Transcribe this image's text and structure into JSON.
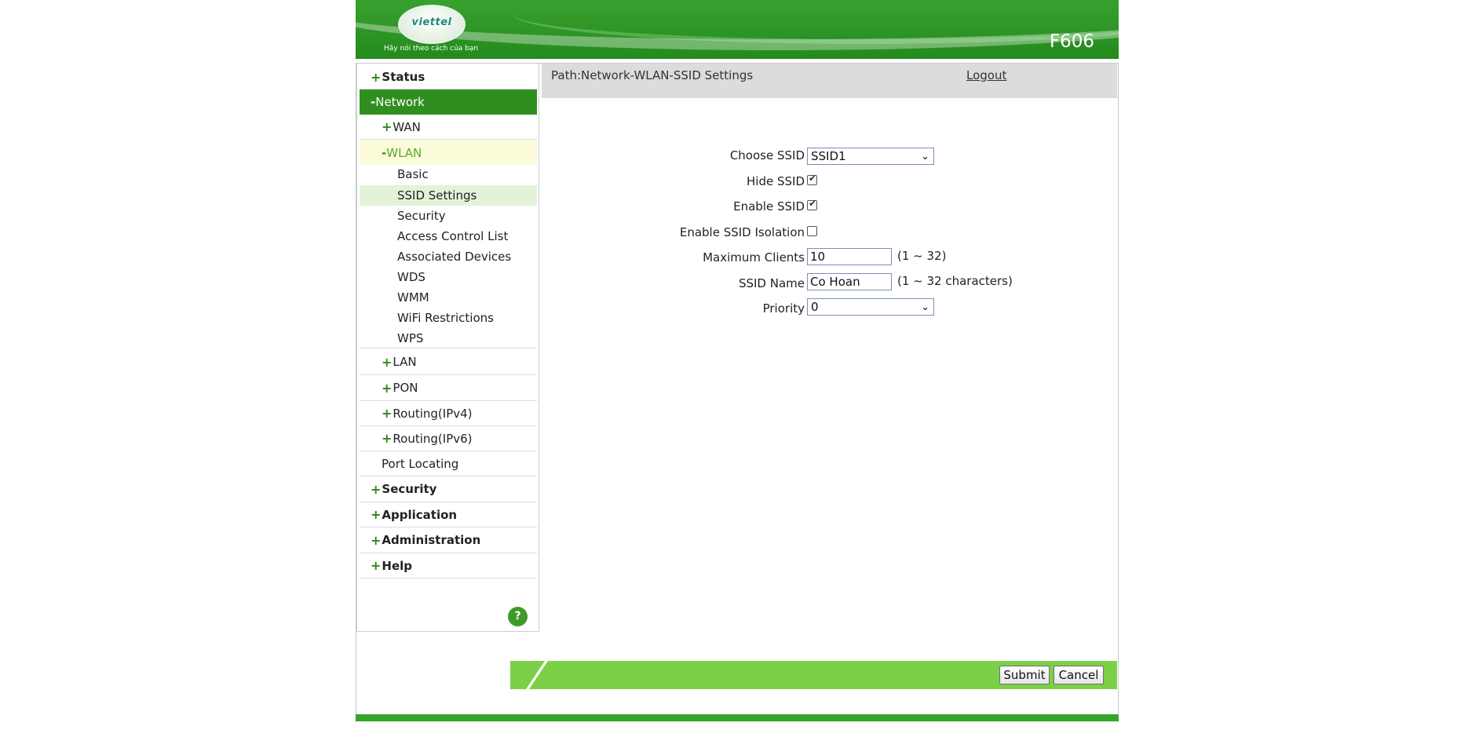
{
  "header": {
    "brand": "viettel",
    "tagline": "Hãy nói theo cách của bạn",
    "model": "F606"
  },
  "sidebar": {
    "status": "Status",
    "network": "Network",
    "wan": "WAN",
    "wlan": "WLAN",
    "wlan_items": [
      "Basic",
      "SSID Settings",
      "Security",
      "Access Control List",
      "Associated Devices",
      "WDS",
      "WMM",
      "WiFi Restrictions",
      "WPS"
    ],
    "lan": "LAN",
    "pon": "PON",
    "routing4": "Routing(IPv4)",
    "routing6": "Routing(IPv6)",
    "port_locating": "Port Locating",
    "security": "Security",
    "application": "Application",
    "administration": "Administration",
    "help": "Help",
    "help_icon": "?"
  },
  "content": {
    "path": "Path:Network-WLAN-SSID Settings",
    "logout": "Logout",
    "form": {
      "choose_ssid_label": "Choose SSID",
      "choose_ssid_value": "SSID1",
      "hide_ssid_label": "Hide SSID",
      "hide_ssid_checked": true,
      "enable_ssid_label": "Enable SSID",
      "enable_ssid_checked": true,
      "isolation_label": "Enable SSID Isolation",
      "isolation_checked": false,
      "max_clients_label": "Maximum Clients",
      "max_clients_value": "10",
      "max_clients_hint": "(1 ~ 32)",
      "ssid_name_label": "SSID Name",
      "ssid_name_value": "Co Hoan",
      "ssid_name_hint": "(1 ~ 32 characters)",
      "priority_label": "Priority",
      "priority_value": "0"
    },
    "buttons": {
      "submit": "Submit",
      "cancel": "Cancel"
    }
  },
  "colors": {
    "brand_green": "#2f8f1e",
    "footer_green": "#7cd048"
  }
}
